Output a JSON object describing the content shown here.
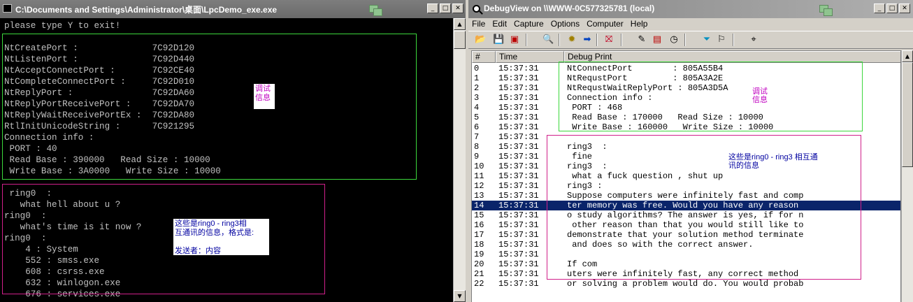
{
  "colors": {
    "annotation_green": "#3cd73c",
    "annotation_magenta": "#d0208a",
    "note_text": "#c000c0",
    "note_blue": "#0000a0",
    "selection": "#0a246a"
  },
  "console": {
    "title": "C:\\Documents and Settings\\Administrator\\桌面\\LpcDemo_exe.exe",
    "lines": [
      "please type Y to exit!",
      "",
      "NtCreatePort :              7C92D120",
      "NtListenPort :              7C92D440",
      "NtAcceptConnectPort :       7C92CE40",
      "NtCompleteConnectPort :     7C92D010",
      "NtReplyPort :               7C92DA60",
      "NtReplyPortReceivePort :    7C92DA70",
      "NtReplyWaitReceivePortEx :  7C92DA80",
      "RtlInitUnicodeString :      7C921295",
      "Connection info :",
      " PORT : 40",
      " Read Base : 390000   Read Size : 10000",
      " Write Base : 3A0000   Write Size : 10000",
      "",
      " ring0  :",
      "   what hell about u ?",
      "ring0  :",
      "   what's time is it now ?",
      "ring0  :",
      "    4 : System",
      "    552 : smss.exe",
      "    608 : csrss.exe",
      "    632 : winlogon.exe",
      "    676 : services.exe"
    ],
    "note_debug_info": [
      "调试",
      "信息"
    ],
    "note_ring_comm": [
      "这些是ring0 - ring3相",
      "互通讯的信息，格式是:",
      "",
      "发送者：内容"
    ]
  },
  "debugview": {
    "title": "DebugView on \\\\WWW-0C577325781 (local)",
    "menu": [
      "File",
      "Edit",
      "Capture",
      "Options",
      "Computer",
      "Help"
    ],
    "columns": [
      "#",
      "Time",
      "Debug Print"
    ],
    "rows": [
      {
        "n": "0",
        "time": "15:37:31",
        "msg": "NtConnectPort        : 805A55B4"
      },
      {
        "n": "1",
        "time": "15:37:31",
        "msg": "NtRequstPort         : 805A3A2E"
      },
      {
        "n": "2",
        "time": "15:37:31",
        "msg": "NtRequstWaitReplyPort : 805A3D5A"
      },
      {
        "n": "3",
        "time": "15:37:31",
        "msg": "Connection info :"
      },
      {
        "n": "4",
        "time": "15:37:31",
        "msg": " PORT : 468"
      },
      {
        "n": "5",
        "time": "15:37:31",
        "msg": " Read Base : 170000   Read Size : 10000"
      },
      {
        "n": "6",
        "time": "15:37:31",
        "msg": " Write Base : 160000   Write Size : 10000"
      },
      {
        "n": "7",
        "time": "15:37:31",
        "msg": ""
      },
      {
        "n": "8",
        "time": "15:37:31",
        "msg": "ring3  :"
      },
      {
        "n": "9",
        "time": "15:37:31",
        "msg": " fine"
      },
      {
        "n": "10",
        "time": "15:37:31",
        "msg": "ring3  :"
      },
      {
        "n": "11",
        "time": "15:37:31",
        "msg": " what a fuck question , shut up"
      },
      {
        "n": "12",
        "time": "15:37:31",
        "msg": "ring3 :"
      },
      {
        "n": "13",
        "time": "15:37:31",
        "msg": "Suppose computers were infinitely fast and comp"
      },
      {
        "n": "14",
        "time": "15:37:31",
        "msg": "ter memory was free. Would you have any reason"
      },
      {
        "n": "15",
        "time": "15:37:31",
        "msg": "o study algorithms? The answer is yes, if for n"
      },
      {
        "n": "16",
        "time": "15:37:31",
        "msg": " other reason than that you would still like to"
      },
      {
        "n": "17",
        "time": "15:37:31",
        "msg": "demonstrate that your solution method terminate"
      },
      {
        "n": "18",
        "time": "15:37:31",
        "msg": " and does so with the correct answer."
      },
      {
        "n": "19",
        "time": "15:37:31",
        "msg": ""
      },
      {
        "n": "20",
        "time": "15:37:31",
        "msg": "If com"
      },
      {
        "n": "21",
        "time": "15:37:31",
        "msg": "uters were infinitely fast, any correct method"
      },
      {
        "n": "22",
        "time": "15:37:31",
        "msg": "or solving a problem would do. You would probab"
      }
    ],
    "selected_row": 14,
    "note_debug_info": [
      "调试",
      "信息"
    ],
    "note_ring_comm": [
      "这些是ring0 - ring3 相互通",
      "讯的信息"
    ]
  }
}
